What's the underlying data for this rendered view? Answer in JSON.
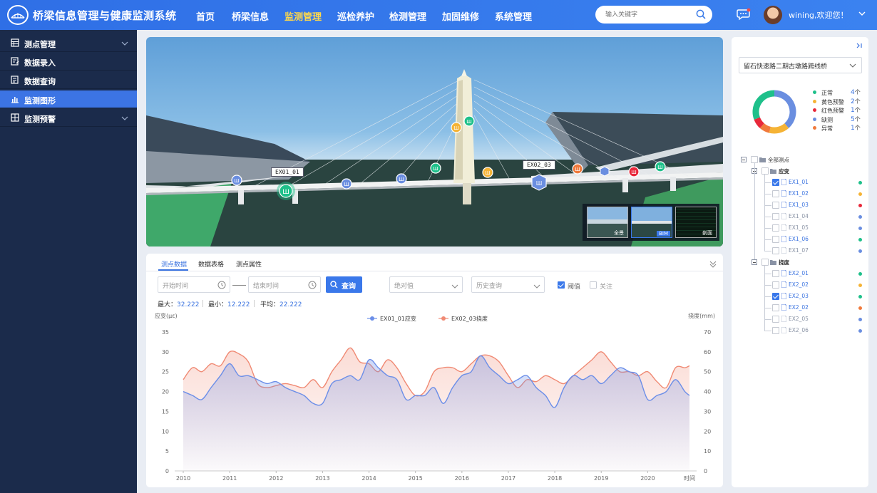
{
  "app": {
    "title": "桥梁信息管理与健康监测系统"
  },
  "nav": {
    "items": [
      "首页",
      "桥梁信息",
      "监测管理",
      "巡检养护",
      "检测管理",
      "加固维修",
      "系统管理"
    ],
    "active_index": 2
  },
  "search": {
    "placeholder": "输入关键字"
  },
  "user": {
    "greeting": "wining,欢迎您！"
  },
  "sidebar": {
    "items": [
      {
        "label": "测点管理",
        "icon": "table-icon",
        "expandable": true
      },
      {
        "label": "数据录入",
        "icon": "edit-icon",
        "expandable": false
      },
      {
        "label": "数据查询",
        "icon": "query-icon",
        "expandable": false
      },
      {
        "label": "监测图形",
        "icon": "chart-icon",
        "expandable": false,
        "active": true
      },
      {
        "label": "监测预警",
        "icon": "alarm-icon",
        "expandable": true
      }
    ]
  },
  "scene": {
    "labels": [
      "EX01_01",
      "EX02_03"
    ],
    "thumbs": [
      {
        "label": "全景"
      },
      {
        "label": "BIM"
      },
      {
        "label": "剖面"
      }
    ]
  },
  "panel": {
    "tabs": [
      "测点数据",
      "数据表格",
      "测点属性"
    ],
    "start_placeholder": "开始时间",
    "end_placeholder": "结束时间",
    "query_label": "查询",
    "value_select": "绝对值",
    "history_select": "历史查询",
    "threshold_label": "阈值",
    "threshold_checked": true,
    "follow_label": "关注",
    "follow_checked": false,
    "stats": {
      "max_label": "最大：",
      "max": "32.222",
      "min_label": "最小：",
      "min": "12.222",
      "avg_label": "平均：",
      "avg": "22.222"
    }
  },
  "chart_data": {
    "type": "area",
    "y_left_label": "应变(με)",
    "y_right_label": "挠度(mm)",
    "x_label": "时间",
    "ylim_left": [
      0,
      35
    ],
    "ylim_right": [
      0,
      70
    ],
    "y_left_ticks": [
      0,
      5,
      10,
      15,
      20,
      25,
      30,
      35
    ],
    "y_right_ticks": [
      0,
      10,
      20,
      30,
      40,
      50,
      60,
      70
    ],
    "x_ticks": [
      "2010",
      "2011",
      "2012",
      "2013",
      "2014",
      "2015",
      "2016",
      "2017",
      "2018",
      "2019",
      "2020"
    ],
    "x_range": [
      2010,
      2020.9
    ],
    "legend_position": "top",
    "grid": false,
    "series": [
      {
        "name": "EX01_01应变",
        "axis": "left",
        "color": "#6b8ee8",
        "x": [
          2010,
          2010.2,
          2010.4,
          2010.6,
          2010.8,
          2011,
          2011.2,
          2011.4,
          2011.6,
          2011.8,
          2012,
          2012.2,
          2012.4,
          2012.6,
          2012.8,
          2013,
          2013.2,
          2013.4,
          2013.6,
          2013.8,
          2014,
          2014.2,
          2014.4,
          2014.6,
          2014.8,
          2015,
          2015.2,
          2015.4,
          2015.6,
          2015.8,
          2016,
          2016.2,
          2016.4,
          2016.6,
          2016.8,
          2017,
          2017.2,
          2017.4,
          2017.6,
          2017.8,
          2018,
          2018.2,
          2018.4,
          2018.6,
          2018.8,
          2019,
          2019.2,
          2019.4,
          2019.6,
          2019.8,
          2020,
          2020.2,
          2020.4,
          2020.6,
          2020.8,
          2020.9
        ],
        "values": [
          20,
          19,
          18,
          21,
          24,
          27,
          24,
          24,
          23,
          22,
          22.5,
          21,
          20,
          19,
          17,
          17,
          22,
          23,
          24,
          23,
          28,
          26,
          24,
          23,
          18,
          19,
          19,
          21,
          17,
          21,
          24,
          25,
          29,
          26,
          24,
          22,
          23,
          24,
          21,
          19,
          16,
          21,
          24,
          23,
          24,
          22,
          24,
          26,
          25,
          24,
          18,
          19,
          20,
          23,
          20,
          19
        ]
      },
      {
        "name": "EX02_03挠度",
        "axis": "right",
        "color": "#f08a74",
        "x": [
          2010,
          2010.2,
          2010.4,
          2010.6,
          2010.8,
          2011,
          2011.2,
          2011.4,
          2011.6,
          2011.8,
          2012,
          2012.2,
          2012.4,
          2012.6,
          2012.8,
          2013,
          2013.2,
          2013.4,
          2013.6,
          2013.8,
          2014,
          2014.2,
          2014.4,
          2014.6,
          2014.8,
          2015,
          2015.2,
          2015.4,
          2015.6,
          2015.8,
          2016,
          2016.2,
          2016.4,
          2016.6,
          2016.8,
          2017,
          2017.2,
          2017.4,
          2017.6,
          2017.8,
          2018,
          2018.2,
          2018.4,
          2018.6,
          2018.8,
          2019,
          2019.2,
          2019.4,
          2019.6,
          2019.8,
          2020,
          2020.2,
          2020.4,
          2020.6,
          2020.8,
          2020.9
        ],
        "values": [
          46,
          52,
          50,
          54,
          53,
          60,
          59,
          55,
          44,
          42,
          43,
          44,
          43,
          42,
          46,
          42,
          50,
          56,
          62,
          55,
          54,
          50,
          56,
          52,
          44,
          38,
          40,
          50,
          52,
          52,
          50,
          54,
          58,
          58,
          55,
          48,
          42,
          46,
          45,
          48,
          46,
          44,
          48,
          52,
          56,
          60,
          55,
          50,
          50,
          48,
          50,
          45,
          42,
          52,
          52,
          53
        ]
      }
    ]
  },
  "right": {
    "bridge": "留石快速路二期古墩路跨线桥",
    "legend": [
      {
        "label": "正常",
        "count": "4",
        "unit": "个",
        "color": "#1ec08a",
        "value": 4
      },
      {
        "label": "黄色预警",
        "count": "2",
        "unit": "个",
        "color": "#f5b335",
        "value": 2
      },
      {
        "label": "红色预警",
        "count": "1",
        "unit": "个",
        "color": "#e8283a",
        "value": 1
      },
      {
        "label": "缺测",
        "count": "5",
        "unit": "个",
        "color": "#6a8ee0",
        "value": 5
      },
      {
        "label": "异常",
        "count": "1",
        "unit": "个",
        "color": "#f07a3c",
        "value": 1
      }
    ],
    "tree_root": "全部测点",
    "groups": [
      {
        "label": "应变",
        "items": [
          {
            "label": "EX1_01",
            "checked": true,
            "active": true,
            "color": "#1ec08a"
          },
          {
            "label": "EX1_02",
            "checked": false,
            "active": true,
            "color": "#f5b335"
          },
          {
            "label": "EX1_03",
            "checked": false,
            "active": true,
            "color": "#e8283a"
          },
          {
            "label": "EX1_04",
            "checked": false,
            "active": false,
            "color": "#6a8ee0"
          },
          {
            "label": "EX1_05",
            "checked": false,
            "active": false,
            "color": "#6a8ee0"
          },
          {
            "label": "EX1_06",
            "checked": false,
            "active": true,
            "color": "#1ec08a"
          },
          {
            "label": "EX1_07",
            "checked": false,
            "active": false,
            "color": "#6a8ee0"
          }
        ]
      },
      {
        "label": "挠度",
        "items": [
          {
            "label": "EX2_01",
            "checked": false,
            "active": true,
            "color": "#1ec08a"
          },
          {
            "label": "EX2_02",
            "checked": false,
            "active": true,
            "color": "#f5b335"
          },
          {
            "label": "EX2_03",
            "checked": true,
            "active": true,
            "color": "#1ec08a"
          },
          {
            "label": "EX2_02",
            "checked": false,
            "active": true,
            "color": "#f07a3c"
          },
          {
            "label": "EX2_05",
            "checked": false,
            "active": false,
            "color": "#6a8ee0"
          },
          {
            "label": "EX2_06",
            "checked": false,
            "active": false,
            "color": "#6a8ee0"
          }
        ]
      }
    ]
  }
}
